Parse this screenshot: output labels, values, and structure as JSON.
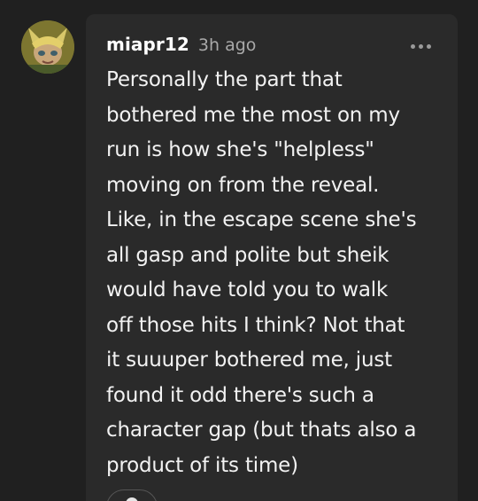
{
  "comment": {
    "username": "miapr12",
    "timestamp": "3h ago",
    "body_lines": [
      "Personally the part that",
      "bothered me the most on my",
      "run is how she's \"helpless\"",
      "moving on from the reveal.",
      "Like, in the escape scene she's",
      "all gasp and polite but sheik",
      "would have told you to walk",
      "off those hits I think? Not that",
      "it suuuper bothered me, just",
      "found it odd there's such a",
      "character gap (but thats also a",
      "product of its time)"
    ]
  },
  "icons": {
    "avatar": "user-avatar",
    "more": "more-options-icon",
    "reaction": "reaction-icon"
  },
  "colors": {
    "background": "#202020",
    "card": "#2a2a2a",
    "text": "#f2f2f2",
    "muted": "#a9a9a9"
  }
}
